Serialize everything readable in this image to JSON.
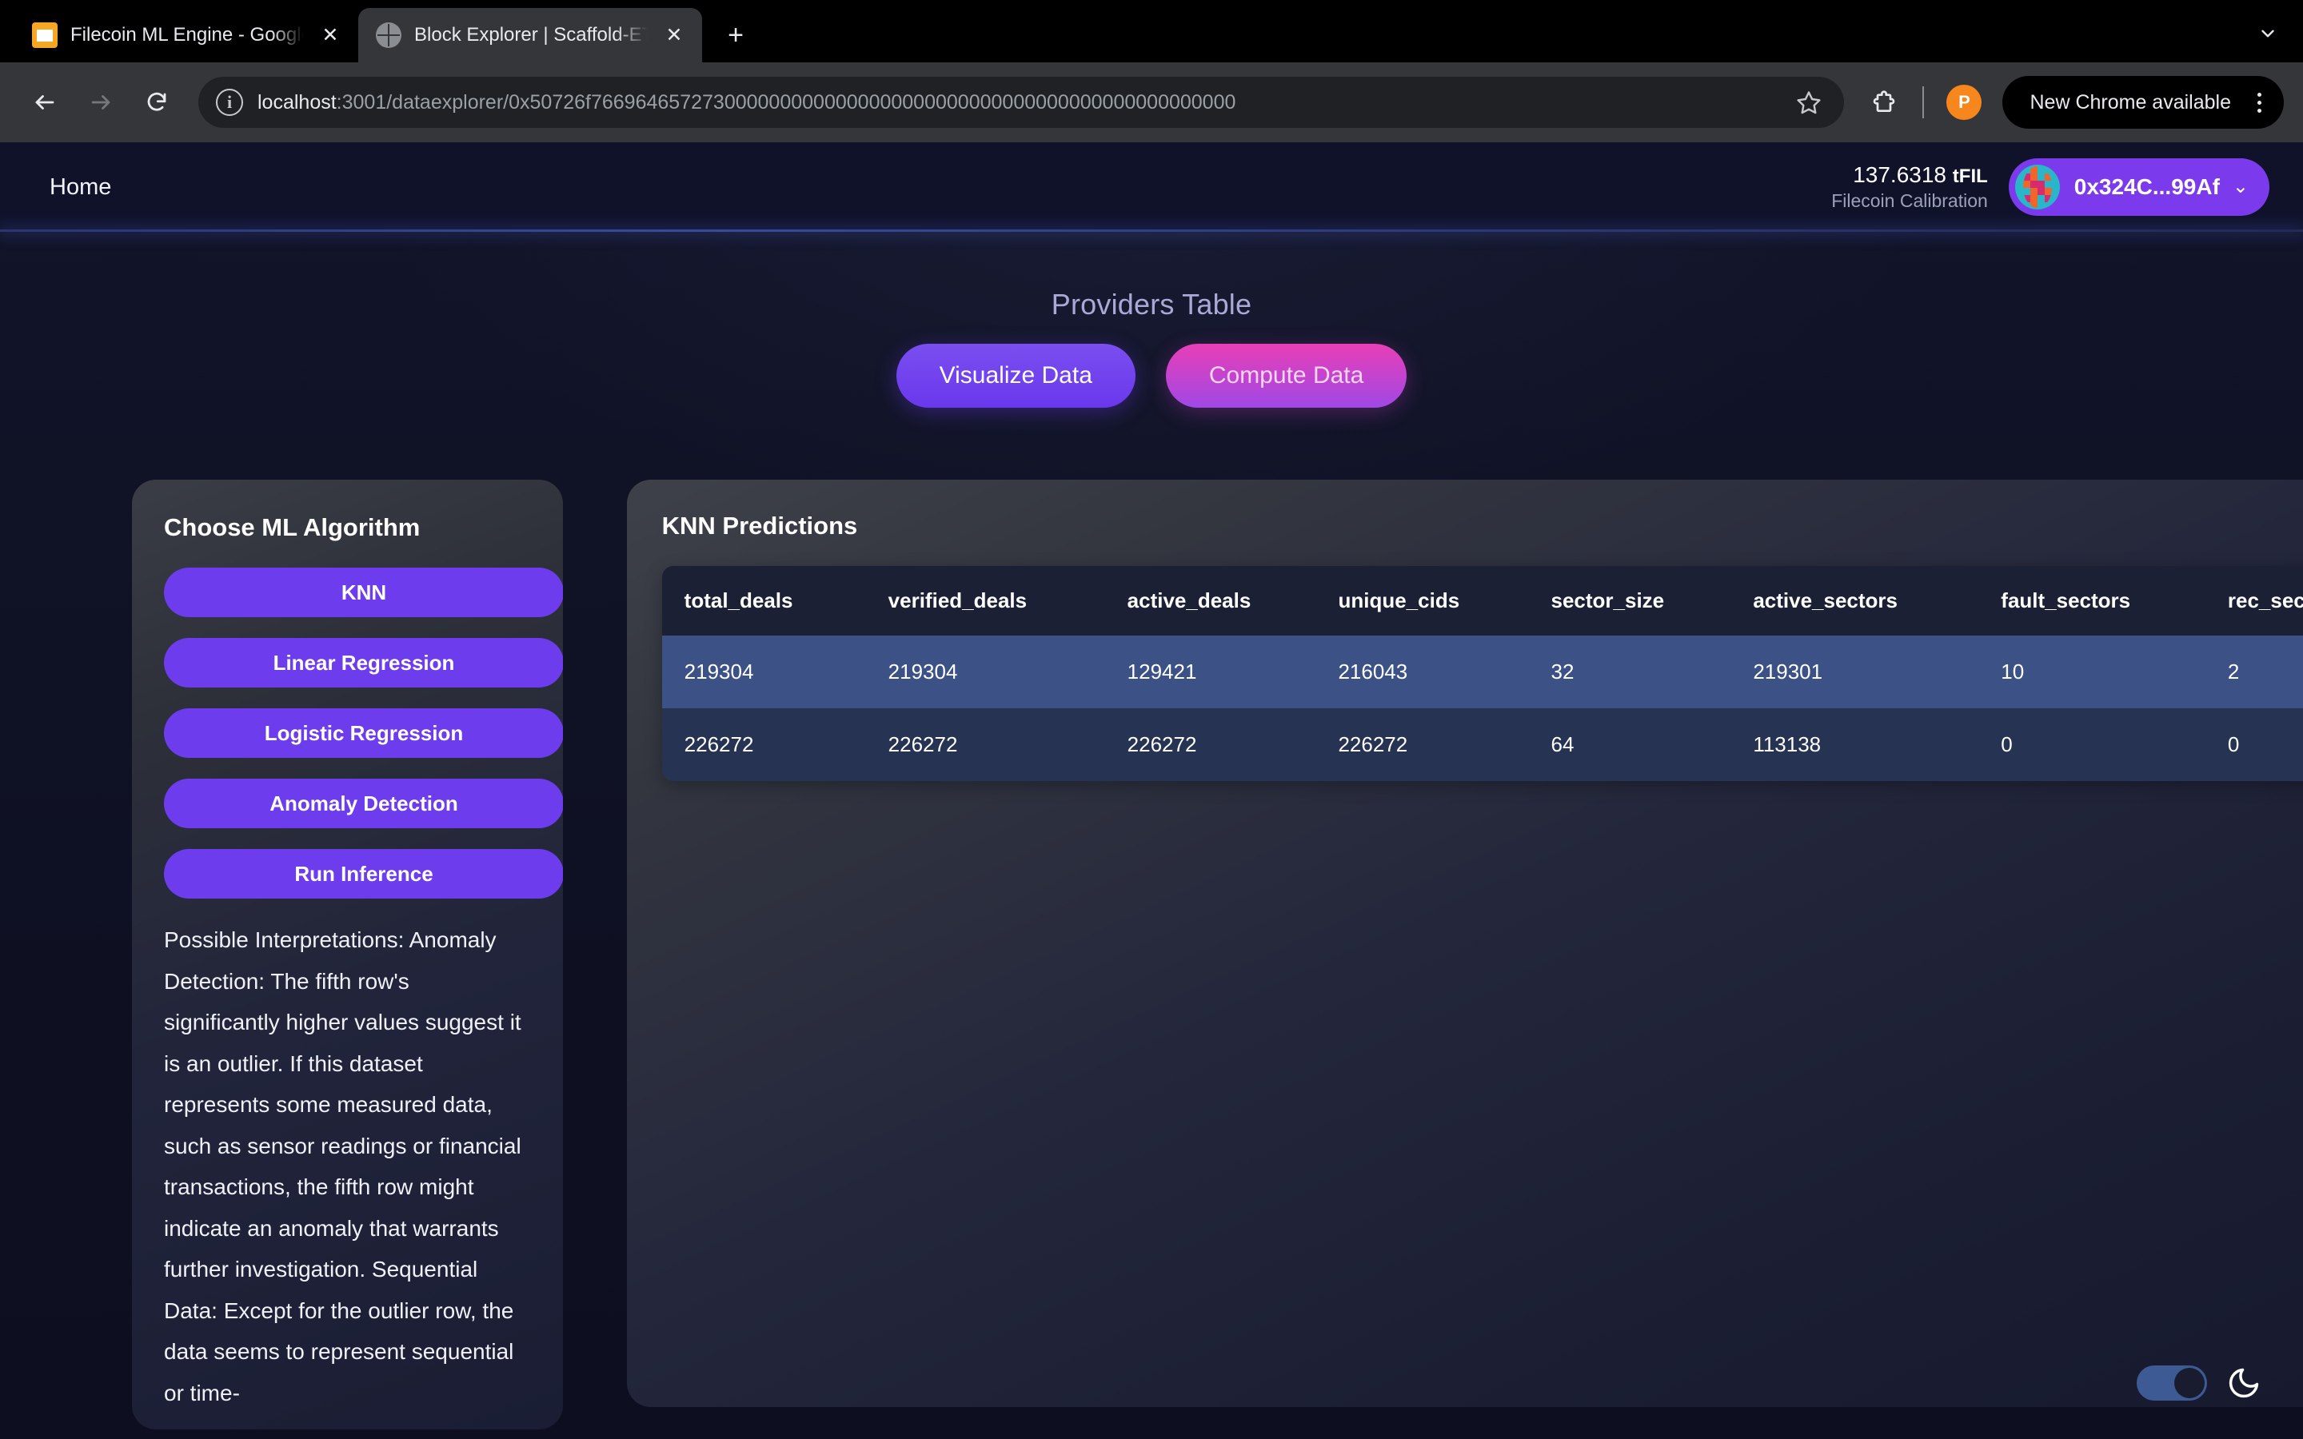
{
  "browser": {
    "tabs": [
      {
        "title": "Filecoin ML Engine - Google S",
        "favicon": "sheets-icon",
        "active": false
      },
      {
        "title": "Block Explorer | Scaffold-ETH",
        "favicon": "globe-icon",
        "active": true
      }
    ],
    "new_tab_label": "+",
    "close_label": "✕",
    "omnibox": {
      "host": "localhost",
      "path": ":3001/dataexplorer/0x50726f7669646572730000000000000000000000000000000000000000000000",
      "info_glyph": "i"
    },
    "profile_initial": "P",
    "update_label": "New Chrome available"
  },
  "site_header": {
    "home_label": "Home",
    "balance_amount": "137.6318",
    "balance_unit": "tFIL",
    "network": "Filecoin Calibration",
    "wallet_address": "0x324C...99Af",
    "wallet_caret": "⌄"
  },
  "hero": {
    "title": "Providers Table",
    "visualize_label": "Visualize Data",
    "compute_label": "Compute Data"
  },
  "sidebar": {
    "title": "Choose ML Algorithm",
    "algorithms": [
      {
        "label": "KNN"
      },
      {
        "label": "Linear Regression"
      },
      {
        "label": "Logistic Regression"
      },
      {
        "label": "Anomaly Detection"
      },
      {
        "label": "Run Inference"
      }
    ],
    "interpretation": "Possible Interpretations: Anomaly Detection: The fifth row's significantly higher values suggest it is an outlier. If this dataset represents some measured data, such as sensor readings or financial transactions, the fifth row might indicate an anomaly that warrants further investigation. Sequential Data: Except for the outlier row, the data seems to represent sequential or time-"
  },
  "content": {
    "title": "KNN Predictions",
    "table": {
      "headers": [
        "total_deals",
        "verified_deals",
        "active_deals",
        "unique_cids",
        "sector_size",
        "active_sectors",
        "fault_sectors",
        "rec_sec"
      ],
      "rows": [
        [
          "219304",
          "219304",
          "129421",
          "216043",
          "32",
          "219301",
          "10",
          "2"
        ],
        [
          "226272",
          "226272",
          "226272",
          "226272",
          "64",
          "113138",
          "0",
          "0"
        ]
      ]
    }
  },
  "theme": {
    "toggle_state": "on",
    "icon": "moon-icon"
  },
  "colors": {
    "accent_purple": "#6d3ced",
    "accent_pink": "#e83fb6",
    "row_highlight": "#3c5286",
    "row_base": "#263353",
    "page_bg": "#0f1124"
  }
}
